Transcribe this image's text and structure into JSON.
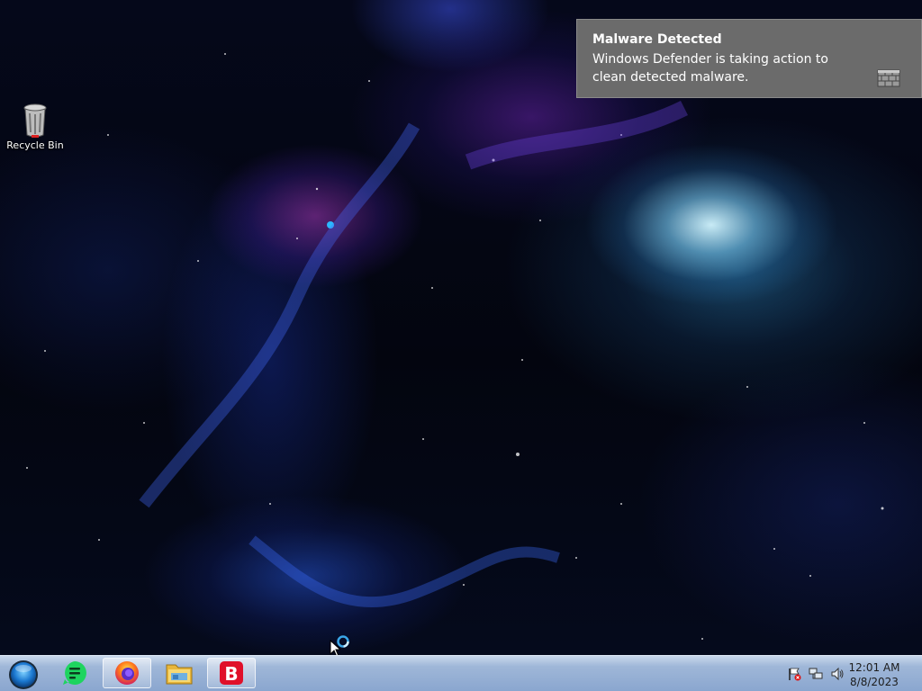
{
  "desktop": {
    "icons": [
      {
        "label": "Recycle Bin",
        "icon": "recycle-bin-icon"
      }
    ]
  },
  "notification": {
    "title": "Malware Detected",
    "message": "Windows Defender is taking action to clean detected malware.",
    "icon": "windows-defender-wall-icon"
  },
  "taskbar": {
    "start_icon": "start-orb-icon",
    "pinned": [
      {
        "icon": "green-notes-app-icon",
        "active": false
      },
      {
        "icon": "firefox-icon",
        "active": true
      },
      {
        "icon": "file-explorer-icon",
        "active": false
      },
      {
        "icon": "red-b-app-icon",
        "active": true
      }
    ],
    "tray_icons": [
      "action-center-flag-icon",
      "network-icon",
      "volume-icon"
    ],
    "clock": {
      "time": "12:01 AM",
      "date": "8/8/2023"
    }
  },
  "colors": {
    "toast_bg": "#6b6b6b",
    "taskbar_top": "#c9d8ec",
    "taskbar_bottom": "#8aa6cf"
  }
}
